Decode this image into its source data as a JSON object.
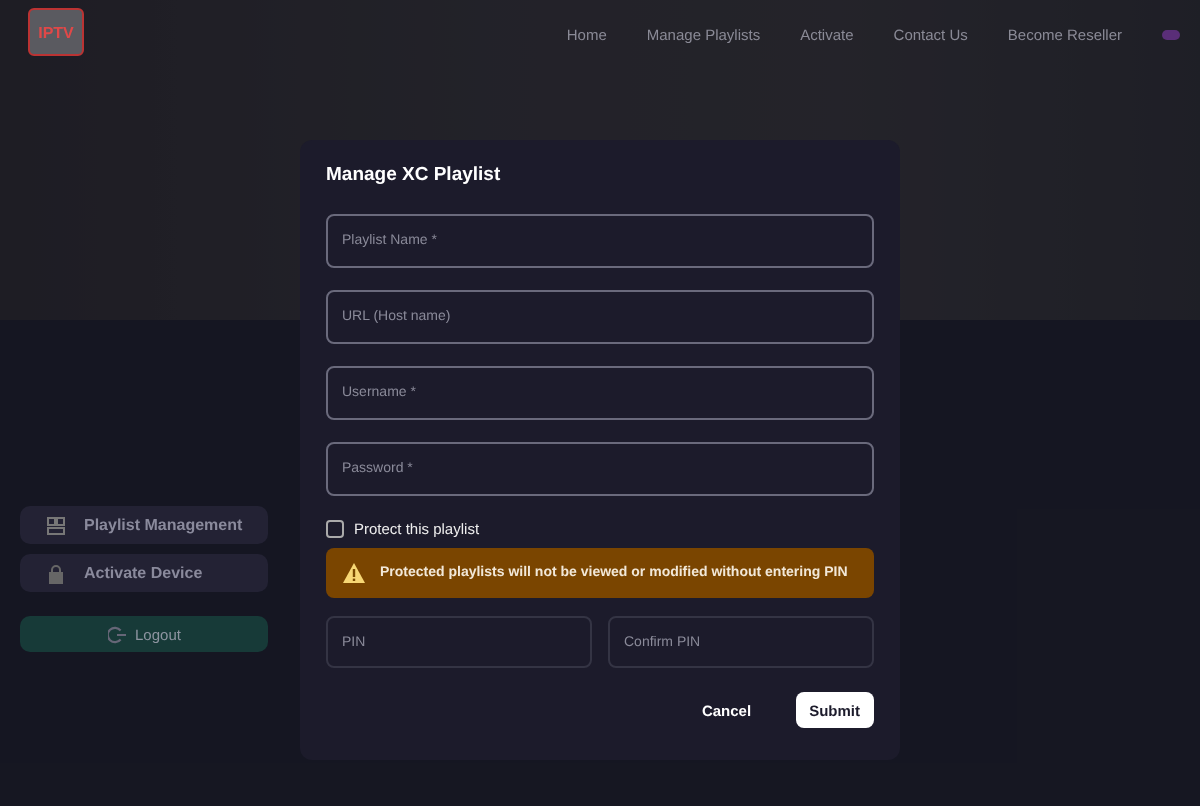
{
  "logo": {
    "text": "IPTV"
  },
  "nav": [
    "Home",
    "Manage Playlists",
    "Activate",
    "Contact Us",
    "Become Reseller"
  ],
  "sidebar": {
    "items": [
      {
        "label": "Playlist Management"
      },
      {
        "label": "Activate Device"
      }
    ],
    "logout": "Logout"
  },
  "modal": {
    "title": "Manage XC Playlist",
    "fields": [
      {
        "placeholder": "Playlist Name *"
      },
      {
        "placeholder": "URL (Host name)"
      },
      {
        "placeholder": "Username *"
      },
      {
        "placeholder": "Password *"
      }
    ],
    "protect": {
      "label": "Protect this playlist",
      "checked": false
    },
    "warning": "Protected playlists will not be viewed or modified without entering PIN",
    "pin_fields": [
      {
        "placeholder": "PIN",
        "disabled": true
      },
      {
        "placeholder": "Confirm PIN",
        "disabled": true
      }
    ],
    "cancel": "Cancel",
    "submit": "Submit"
  }
}
